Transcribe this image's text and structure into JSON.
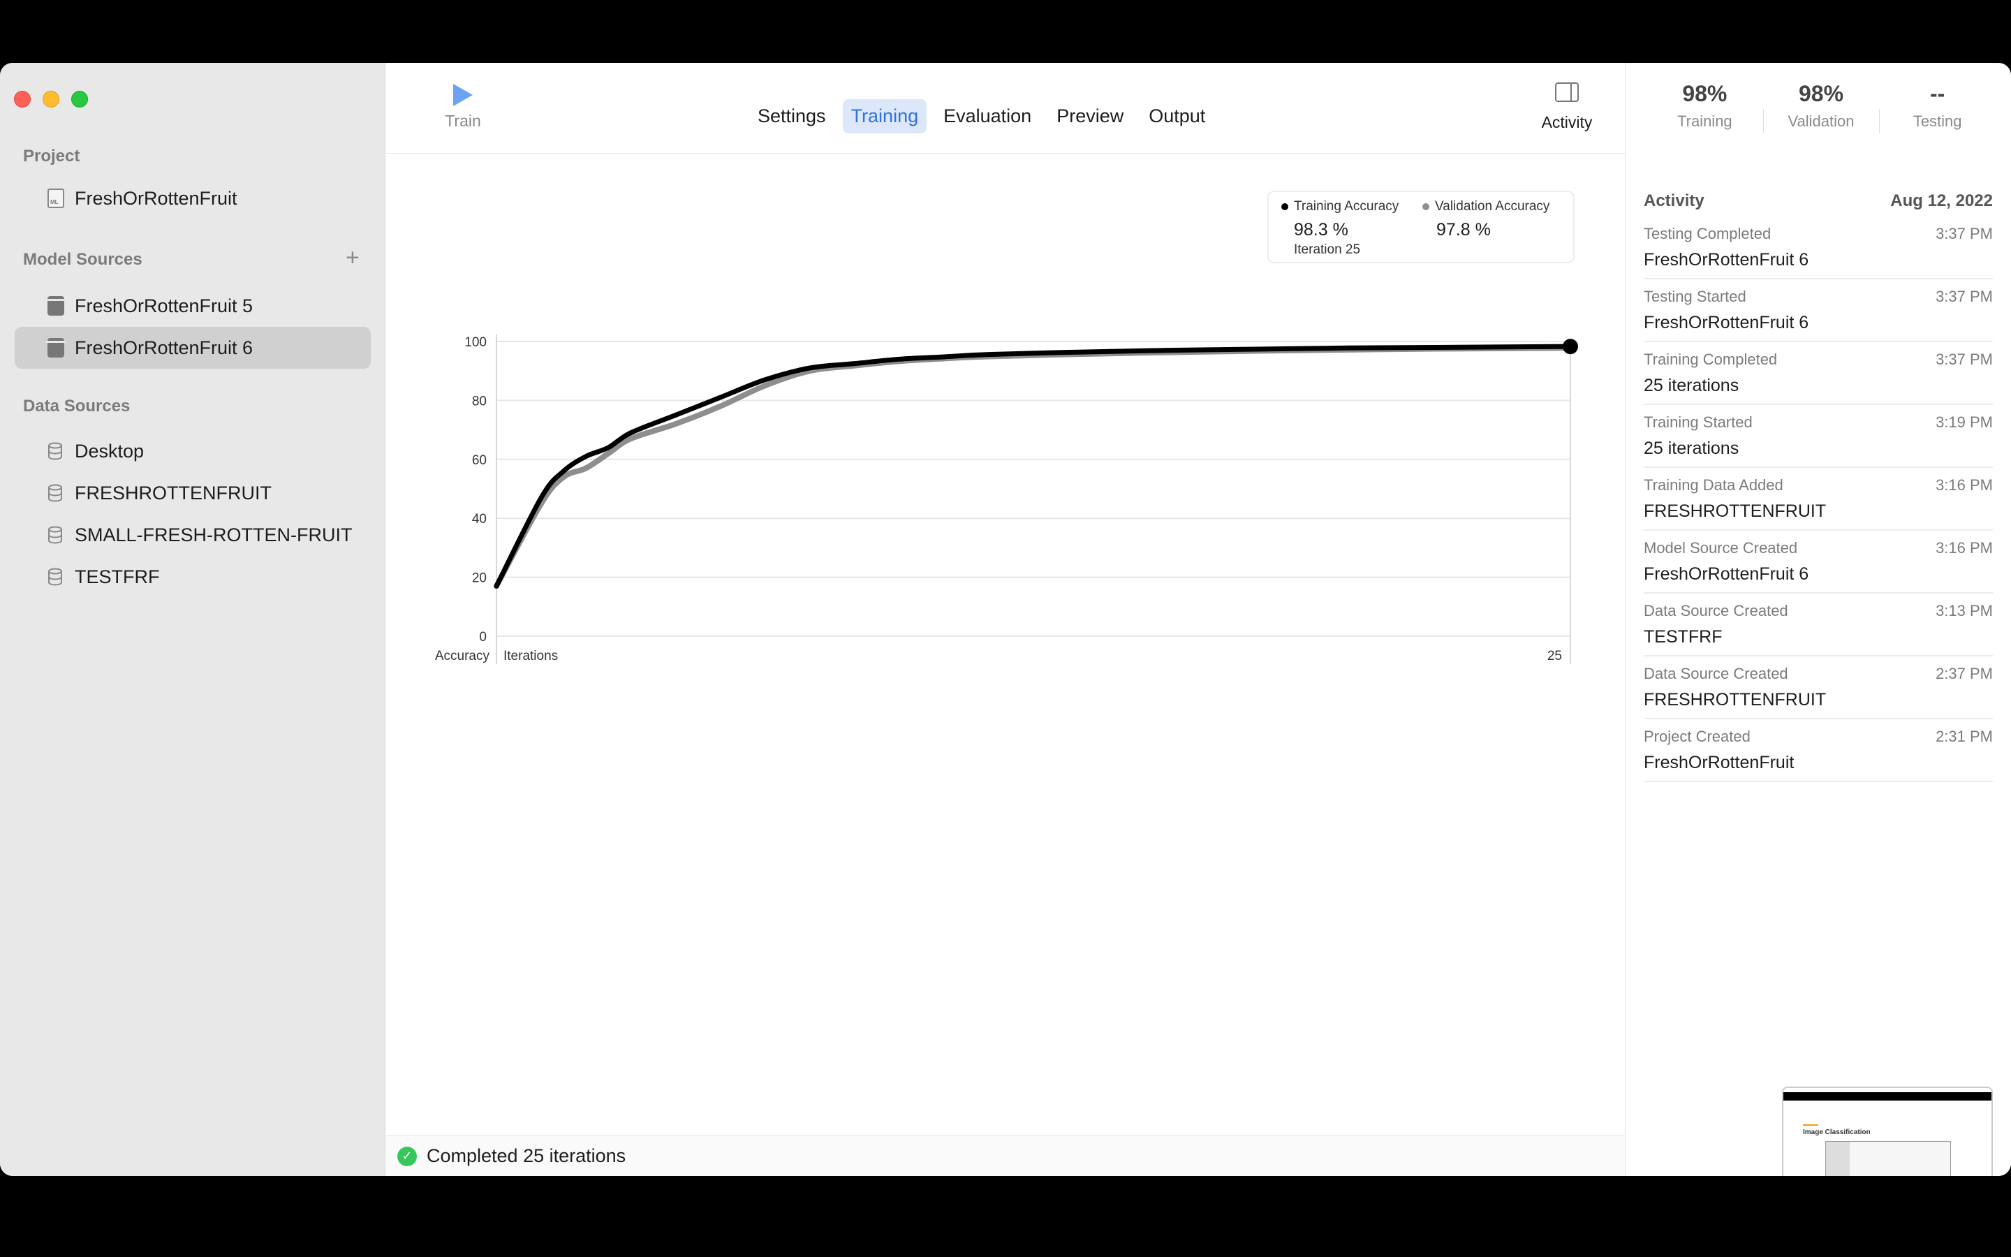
{
  "sidebar": {
    "project_title": "Project",
    "project_name": "FreshOrRottenFruit",
    "model_sources_title": "Model Sources",
    "add_label": "+",
    "models": [
      "FreshOrRottenFruit 5",
      "FreshOrRottenFruit 6"
    ],
    "selected_model_index": 1,
    "data_sources_title": "Data Sources",
    "data_sources": [
      "Desktop",
      "FRESHROTTENFRUIT",
      "SMALL-FRESH-ROTTEN-FRUIT",
      "TESTFRF"
    ]
  },
  "toolbar": {
    "train_label": "Train",
    "tabs": [
      "Settings",
      "Training",
      "Evaluation",
      "Preview",
      "Output"
    ],
    "active_tab": "Training",
    "activity_label": "Activity"
  },
  "legend": {
    "training_label": "Training Accuracy",
    "training_value": "98.3 %",
    "validation_label": "Validation Accuracy",
    "validation_value": "97.8 %",
    "iteration": "Iteration 25"
  },
  "chart_data": {
    "type": "line",
    "ylabel": "Accuracy",
    "xlabel": "Iterations",
    "x_end_label": "25",
    "ylim": [
      0,
      100
    ],
    "xlim": [
      1,
      25
    ],
    "yticks": [
      "0",
      "20",
      "40",
      "60",
      "80",
      "100"
    ],
    "x": [
      1,
      2,
      2.5,
      3,
      3.5,
      4,
      5,
      6,
      7,
      8,
      9,
      10,
      11,
      12,
      14,
      16,
      18,
      20,
      22,
      25
    ],
    "series": [
      {
        "name": "Training Accuracy",
        "color": "#000000",
        "values": [
          17,
          47,
          56,
          61,
          64,
          69,
          75,
          81,
          87,
          91,
          92.5,
          94,
          94.8,
          95.6,
          96.4,
          97,
          97.4,
          97.8,
          98,
          98.3
        ]
      },
      {
        "name": "Validation Accuracy",
        "color": "#8e8e8e",
        "values": [
          17,
          45,
          54,
          57,
          62,
          67,
          72,
          78,
          85,
          90,
          91.8,
          93.3,
          94.2,
          94.9,
          95.7,
          96.3,
          96.8,
          97.2,
          97.5,
          97.8
        ]
      }
    ]
  },
  "status": {
    "text": "Completed 25 iterations"
  },
  "metrics": [
    {
      "value": "98%",
      "label": "Training"
    },
    {
      "value": "98%",
      "label": "Validation"
    },
    {
      "value": "--",
      "label": "Testing"
    }
  ],
  "activity": {
    "title": "Activity",
    "date": "Aug 12, 2022",
    "items": [
      {
        "title": "Testing Completed",
        "time": "3:37 PM",
        "subtitle": "FreshOrRottenFruit 6"
      },
      {
        "title": "Testing Started",
        "time": "3:37 PM",
        "subtitle": "FreshOrRottenFruit 6"
      },
      {
        "title": "Training Completed",
        "time": "3:37 PM",
        "subtitle": "25 iterations"
      },
      {
        "title": "Training Started",
        "time": "3:19 PM",
        "subtitle": "25 iterations"
      },
      {
        "title": "Training Data Added",
        "time": "3:16 PM",
        "subtitle": "FRESHROTTENFRUIT"
      },
      {
        "title": "Model Source Created",
        "time": "3:16 PM",
        "subtitle": "FreshOrRottenFruit 6"
      },
      {
        "title": "Data Source Created",
        "time": "3:13 PM",
        "subtitle": "TESTFRF"
      },
      {
        "title": "Data Source Created",
        "time": "2:37 PM",
        "subtitle": "FRESHROTTENFRUIT"
      },
      {
        "title": "Project Created",
        "time": "2:31 PM",
        "subtitle": "FreshOrRottenFruit"
      }
    ]
  },
  "thumbnail": {
    "title": "Image Classification"
  }
}
